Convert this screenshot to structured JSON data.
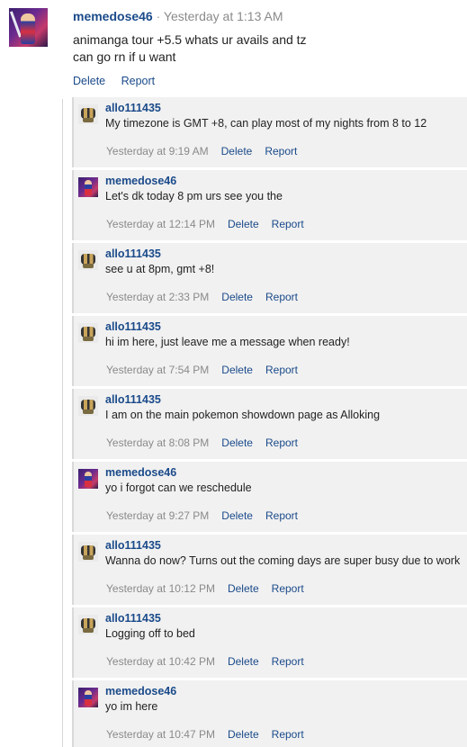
{
  "post": {
    "author": "memedose46",
    "separator": "·",
    "timestamp": "Yesterday at 1:13 AM",
    "lines": [
      "animanga tour +5.5 whats ur avails and tz",
      "can go rn if u want"
    ],
    "delete_label": "Delete",
    "report_label": "Report"
  },
  "comments": [
    {
      "author": "allo111435",
      "text": "My timezone is GMT +8, can play most of my nights from 8 to 12",
      "time": "Yesterday at 9:19 AM",
      "delete": "Delete",
      "report": "Report",
      "avatar": "allo-avatar"
    },
    {
      "author": "memedose46",
      "text": "Let's dk today 8 pm urs see you the",
      "time": "Yesterday at 12:14 PM",
      "delete": "Delete",
      "report": "Report",
      "avatar": "memedose-avatar"
    },
    {
      "author": "allo111435",
      "text": "see u at 8pm, gmt +8!",
      "time": "Yesterday at 2:33 PM",
      "delete": "Delete",
      "report": "Report",
      "avatar": "allo-avatar"
    },
    {
      "author": "allo111435",
      "text": "hi im here, just leave me a message when ready!",
      "time": "Yesterday at 7:54 PM",
      "delete": "Delete",
      "report": "Report",
      "avatar": "allo-avatar"
    },
    {
      "author": "allo111435",
      "text": "I am on the main pokemon showdown page as Alloking",
      "time": "Yesterday at 8:08 PM",
      "delete": "Delete",
      "report": "Report",
      "avatar": "allo-avatar"
    },
    {
      "author": "memedose46",
      "text": "yo i forgot can we reschedule",
      "time": "Yesterday at 9:27 PM",
      "delete": "Delete",
      "report": "Report",
      "avatar": "memedose-avatar"
    },
    {
      "author": "allo111435",
      "text": "Wanna do now? Turns out the coming days are super busy due to work",
      "time": "Yesterday at 10:12 PM",
      "delete": "Delete",
      "report": "Report",
      "avatar": "allo-avatar"
    },
    {
      "author": "allo111435",
      "text": "Logging off to bed",
      "time": "Yesterday at 10:42 PM",
      "delete": "Delete",
      "report": "Report",
      "avatar": "allo-avatar"
    },
    {
      "author": "memedose46",
      "text": "yo im here",
      "time": "Yesterday at 10:47 PM",
      "delete": "Delete",
      "report": "Report",
      "avatar": "memedose-avatar"
    }
  ]
}
